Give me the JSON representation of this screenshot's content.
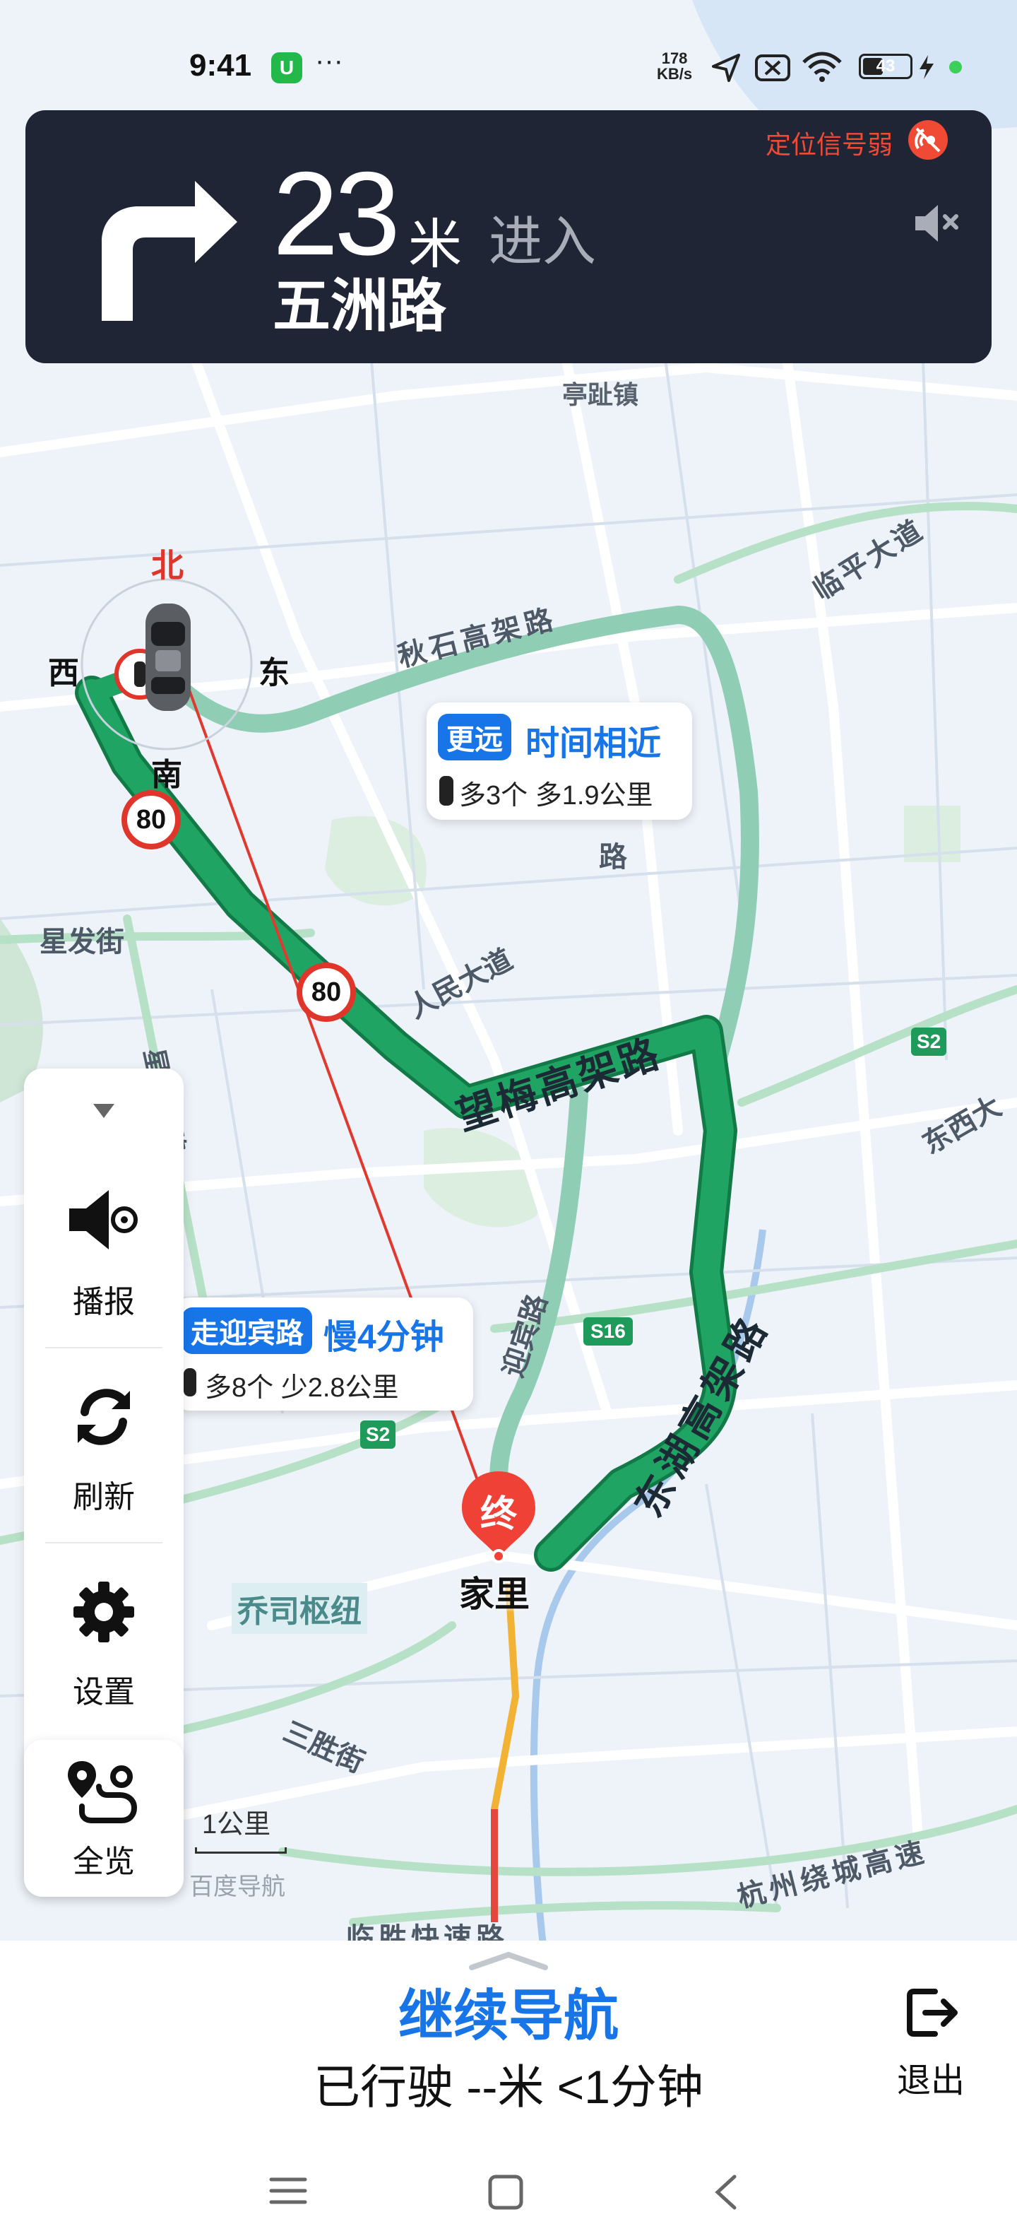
{
  "status_bar": {
    "time": "9:41",
    "app_badge": "U",
    "more_dots": "···",
    "net_speed_value": "178",
    "net_speed_unit": "KB/s",
    "battery_level": "43",
    "battery_fraction": 0.43
  },
  "nav_banner": {
    "turn_icon": "turn-right-arrow-icon",
    "distance_value": "23",
    "distance_unit": "米",
    "enter_label": "进入",
    "road_name": "五洲路",
    "gps_status": "定位信号弱",
    "gps_icon": "gps-weak-icon",
    "mute_icon": "speaker-muted-icon"
  },
  "compass": {
    "north": "北",
    "south": "南",
    "east": "东",
    "west": "西"
  },
  "speed_limits": [
    "80",
    "80"
  ],
  "route_alt_1": {
    "tag": "更远",
    "main": "时间相近",
    "sub": "多3个 多1.9公里"
  },
  "route_alt_2": {
    "tag": "走迎宾路",
    "main": "慢4分钟",
    "sub": "多8个 少2.8公里"
  },
  "map_labels": {
    "ting_zhi": "亭趾镇",
    "qiu_shi": "秋石高架路",
    "lin_ping": "临平大道",
    "xing_fa": "星发街",
    "ren_min": "人民大道",
    "wang_mei": "望梅高架路",
    "dong_hu": "东湖高架路",
    "ying_bin": "迎宾路",
    "dong_xi": "东西大",
    "qiao_si": "乔司枢纽",
    "san_sheng": "三胜街",
    "hangzhou_ring": "杭州绕城高速",
    "fast_road": "临胜快速路",
    "lu_small": "路",
    "xing_nan": "星光南路",
    "s2_a": "S2",
    "s2_b": "S2",
    "s16": "S16",
    "end_marker": "终",
    "destination": "家里"
  },
  "side_panel": {
    "collapse_icon": "triangle-down-icon",
    "broadcast": "播报",
    "refresh": "刷新",
    "settings": "设置",
    "overview": "全览"
  },
  "scale": {
    "label": "1公里",
    "watermark": "百度导航"
  },
  "bottom": {
    "continue": "继续导航",
    "driven": "已行驶 --米 <1分钟",
    "exit": "退出"
  },
  "colors": {
    "route_green": "#1fa463",
    "alt_route": "#8fcdb4",
    "accent_blue": "#1775e8",
    "banner_bg": "#1f2535",
    "warning_red": "#f04a35"
  }
}
